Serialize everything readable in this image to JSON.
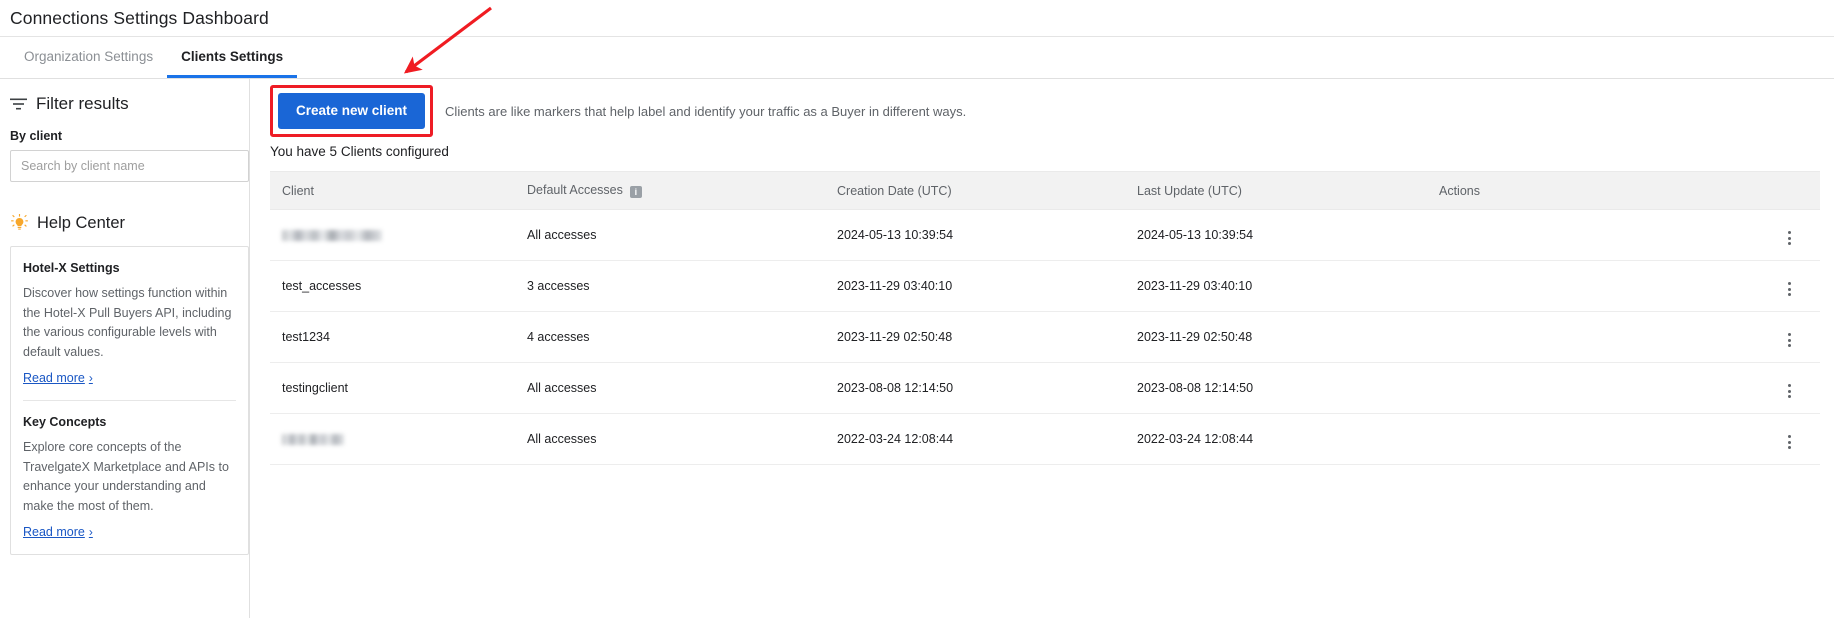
{
  "header": {
    "title": "Connections Settings Dashboard"
  },
  "tabs": [
    {
      "label": "Organization Settings",
      "active": false
    },
    {
      "label": "Clients Settings",
      "active": true
    }
  ],
  "sidebar": {
    "filter": {
      "title": "Filter results",
      "icon": "filter-icon",
      "field_label": "By client",
      "search_placeholder": "Search by client name",
      "search_value": ""
    },
    "help_center": {
      "title": "Help Center",
      "icon": "lightbulb-icon",
      "items": [
        {
          "title": "Hotel-X Settings",
          "text": "Discover how settings function within the Hotel-X Pull Buyers API, including the various configurable levels with default values.",
          "link": "Read more",
          "chevron": "›"
        },
        {
          "title": "Key Concepts",
          "text": "Explore core concepts of the TravelgateX Marketplace and APIs to enhance your understanding and make the most of them.",
          "link": "Read more",
          "chevron": "›"
        }
      ]
    }
  },
  "main": {
    "create_button": "Create new client",
    "description": "Clients are like markers that help label and identify your traffic as a Buyer in different ways.",
    "configured_count_line": "You have 5 Clients configured",
    "table": {
      "columns": [
        "Client",
        "Default Accesses",
        "Creation Date (UTC)",
        "Last Update (UTC)",
        "Actions"
      ],
      "info_badge": "i",
      "rows": [
        {
          "client": "",
          "client_blurred": true,
          "client_blur_width": 100,
          "default_accesses": "All accesses",
          "creation_date": "2024-05-13 10:39:54",
          "last_update": "2024-05-13 10:39:54"
        },
        {
          "client": "test_accesses",
          "client_blurred": false,
          "default_accesses": "3 accesses",
          "creation_date": "2023-11-29 03:40:10",
          "last_update": "2023-11-29 03:40:10"
        },
        {
          "client": "test1234",
          "client_blurred": false,
          "default_accesses": "4 accesses",
          "creation_date": "2023-11-29 02:50:48",
          "last_update": "2023-11-29 02:50:48"
        },
        {
          "client": "testingclient",
          "client_blurred": false,
          "default_accesses": "All accesses",
          "creation_date": "2023-08-08 12:14:50",
          "last_update": "2023-08-08 12:14:50"
        },
        {
          "client": "",
          "client_blurred": true,
          "client_blur_width": 62,
          "default_accesses": "All accesses",
          "creation_date": "2022-03-24 12:08:44",
          "last_update": "2022-03-24 12:08:44"
        }
      ]
    }
  },
  "annotations": {
    "highlight_color": "#ee1c25",
    "arrow_color": "#f01c22",
    "accent_color": "#1a73e8",
    "button_color": "#1a66d6"
  }
}
